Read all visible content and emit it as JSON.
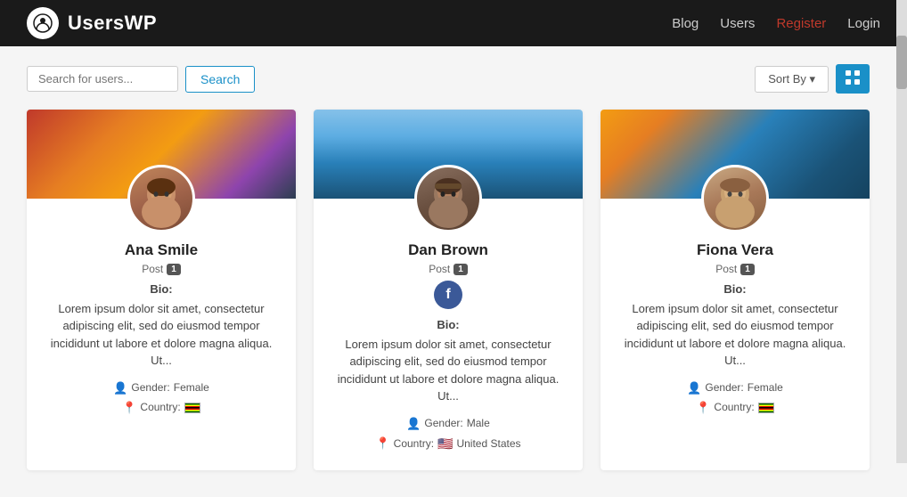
{
  "header": {
    "logo_text": "UsersWP",
    "nav_items": [
      {
        "label": "Blog",
        "href": "#",
        "active": false
      },
      {
        "label": "Users",
        "href": "#",
        "active": false
      },
      {
        "label": "Register",
        "href": "#",
        "active": true
      },
      {
        "label": "Login",
        "href": "#",
        "active": false
      }
    ]
  },
  "search": {
    "placeholder": "Search for users...",
    "button_label": "Search"
  },
  "toolbar": {
    "sort_label": "Sort By ▾",
    "grid_icon": "⊞"
  },
  "users": [
    {
      "name": "Ana Smile",
      "post_label": "Post",
      "post_count": "1",
      "banner_class": "banner-sunset",
      "avatar_class": "avatar-ana",
      "has_facebook": false,
      "bio_label": "Bio:",
      "bio_text": "Lorem ipsum dolor sit amet, consectetur adipiscing elit, sed do eiusmod tempor incididunt ut labore et dolore magna aliqua. Ut...",
      "gender_label": "Gender:",
      "gender_value": "Female",
      "country_label": "Country:",
      "country_flag": "zw",
      "country_name": ""
    },
    {
      "name": "Dan Brown",
      "post_label": "Post",
      "post_count": "1",
      "banner_class": "banner-mountain",
      "avatar_class": "avatar-dan",
      "has_facebook": true,
      "bio_label": "Bio:",
      "bio_text": "Lorem ipsum dolor sit amet, consectetur adipiscing elit, sed do eiusmod tempor incididunt ut labore et dolore magna aliqua. Ut...",
      "gender_label": "Gender:",
      "gender_value": "Male",
      "country_label": "Country:",
      "country_flag": "us",
      "country_name": "United States"
    },
    {
      "name": "Fiona Vera",
      "post_label": "Post",
      "post_count": "1",
      "banner_class": "banner-beach",
      "avatar_class": "avatar-fiona",
      "has_facebook": false,
      "bio_label": "Bio:",
      "bio_text": "Lorem ipsum dolor sit amet, consectetur adipiscing elit, sed do eiusmod tempor incididunt ut labore et dolore magna aliqua. Ut...",
      "gender_label": "Gender:",
      "gender_value": "Female",
      "country_label": "Country:",
      "country_flag": "zw",
      "country_name": ""
    }
  ]
}
